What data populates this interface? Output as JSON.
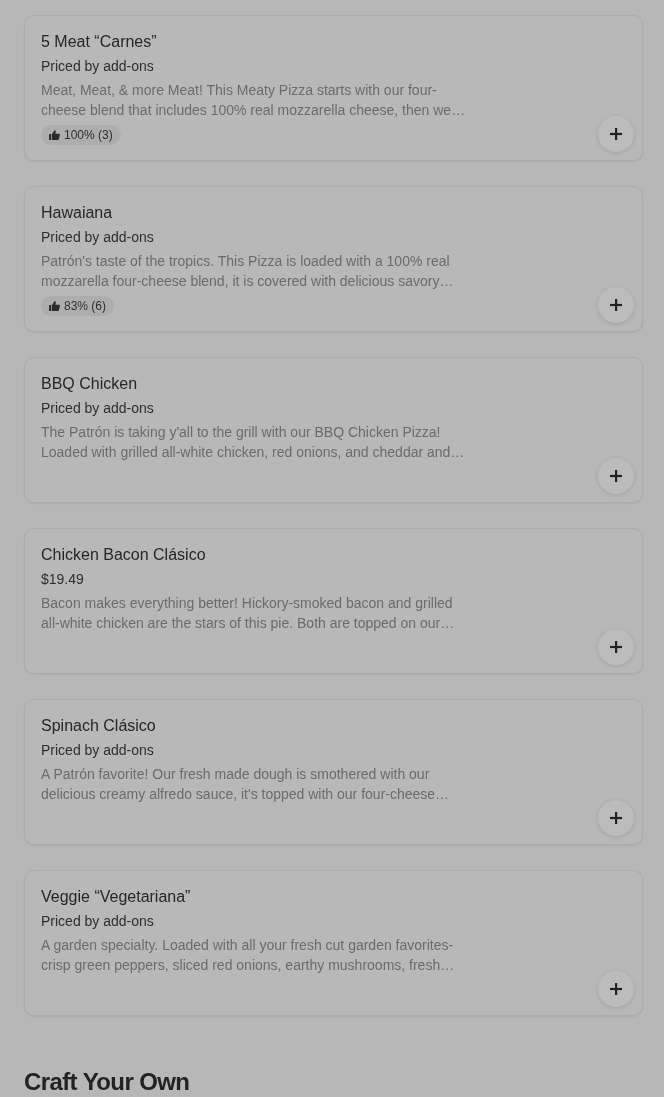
{
  "menu_items": [
    {
      "name": "5 Meat “Carnes”",
      "price": "Priced by add-ons",
      "description": "Meat, Meat, & more Meat! This Meaty Pizza starts with our four-cheese blend that includes 100% real mozzarella cheese, then we…",
      "rating": "100% (3)"
    },
    {
      "name": "Hawaiana",
      "price": "Priced by add-ons",
      "description": "Patrón's taste of the tropics. This Pizza is loaded with a 100% real mozzarella four-cheese blend, it is covered with delicious savory…",
      "rating": "83% (6)"
    },
    {
      "name": "BBQ Chicken",
      "price": "Priced by add-ons",
      "description": "The Patrón is taking y'all to the grill with our BBQ Chicken Pizza! Loaded with grilled all-white chicken, red onions, and cheddar and…"
    },
    {
      "name": "Chicken Bacon Clásico",
      "price": "$19.49",
      "description": "Bacon makes everything better! Hickory-smoked bacon and grilled all-white chicken are the stars of this pie. Both are topped on our…"
    },
    {
      "name": "Spinach Clásico",
      "price": "Priced by add-ons",
      "description": "A Patrón favorite! Our fresh made dough is smothered with our delicious creamy alfredo sauce, it's topped with our four-cheese…"
    },
    {
      "name": "Veggie “Vegetariana”",
      "price": "Priced by add-ons",
      "description": "A garden specialty. Loaded with all your fresh cut garden favorites-crisp green peppers, sliced red onions, earthy mushrooms, fresh…"
    }
  ],
  "section_heading": "Craft Your Own"
}
